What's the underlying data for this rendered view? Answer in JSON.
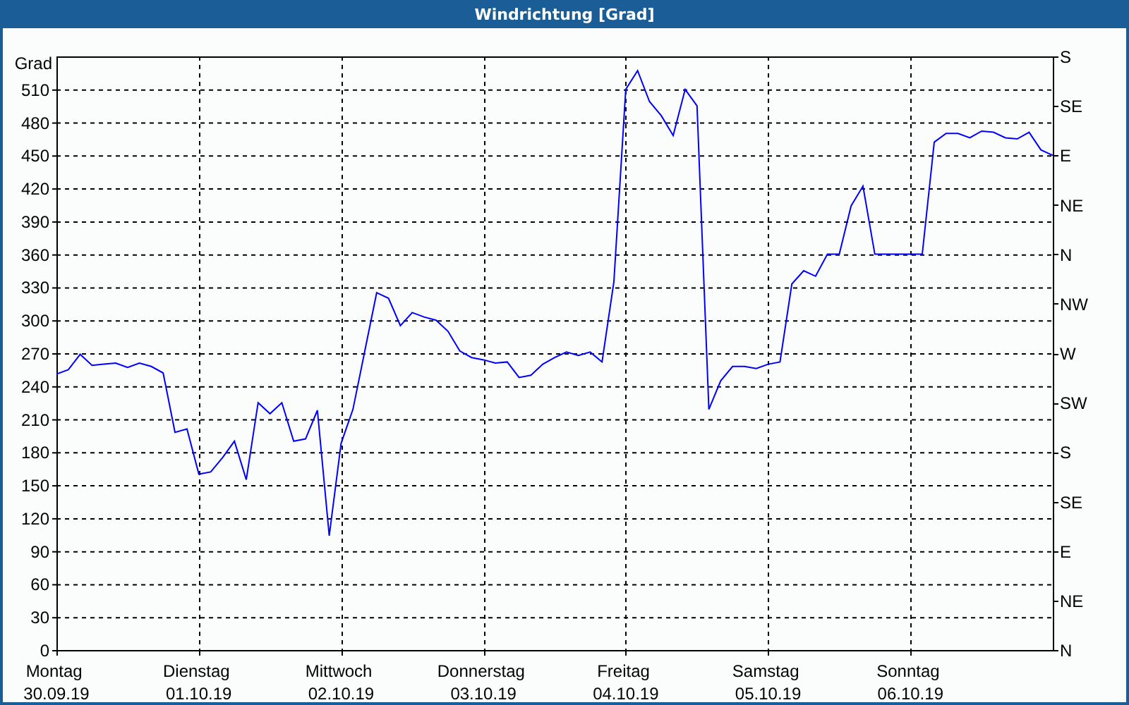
{
  "window": {
    "title": "Windrichtung [Grad]"
  },
  "chart": {
    "chart_data": {
      "type": "line",
      "grid": true,
      "ylabel": "Grad",
      "ylim": [
        0,
        540
      ],
      "yticks": [
        0,
        30,
        60,
        90,
        120,
        150,
        180,
        210,
        240,
        270,
        300,
        330,
        360,
        390,
        420,
        450,
        480,
        510
      ],
      "categories": [
        "Montag 30.09.19",
        null,
        null,
        null,
        null,
        null,
        null,
        null,
        null,
        null,
        null,
        null,
        "Dienstag 01.10.19",
        null,
        null,
        null,
        null,
        null,
        null,
        null,
        null,
        null,
        null,
        null,
        "Mittwoch 02.10.19",
        null,
        null,
        null,
        null,
        null,
        null,
        null,
        null,
        null,
        null,
        null,
        "Donnerstag 03.10.19",
        null,
        null,
        null,
        null,
        null,
        null,
        null,
        null,
        null,
        null,
        null,
        "Freitag 04.10.19",
        null,
        null,
        null,
        null,
        null,
        null,
        null,
        null,
        null,
        null,
        null,
        "Samstag 05.10.19",
        null,
        null,
        null,
        null,
        null,
        null,
        null,
        null,
        null,
        null,
        null,
        "Sonntag 06.10.19",
        null,
        null,
        null,
        null,
        null,
        null,
        null,
        null,
        null,
        null,
        null,
        null
      ],
      "series": [
        {
          "color": "#0000ff",
          "values": [
            251,
            255,
            269,
            259,
            260,
            261,
            257,
            261,
            258,
            252,
            198,
            201,
            160,
            162,
            175,
            190,
            155,
            225,
            215,
            225,
            190,
            192,
            218,
            104,
            188,
            219,
            272,
            325,
            320,
            295,
            307,
            303,
            300,
            290,
            272,
            266,
            264,
            261,
            262,
            248,
            250,
            260,
            266,
            271,
            268,
            271,
            262,
            335,
            510,
            527,
            499,
            486,
            468,
            510,
            495,
            219,
            245,
            258,
            258,
            256,
            260,
            262,
            333,
            345,
            340,
            360,
            360,
            404,
            422,
            360,
            360,
            360,
            360,
            360,
            462,
            470,
            470,
            466,
            472,
            471,
            466,
            465,
            471,
            455,
            450
          ]
        }
      ]
    },
    "compass_labels": [
      "S",
      "SE",
      "E",
      "NE",
      "N",
      "NW",
      "W",
      "SW",
      "S",
      "SE",
      "E",
      "NE",
      "N"
    ]
  }
}
